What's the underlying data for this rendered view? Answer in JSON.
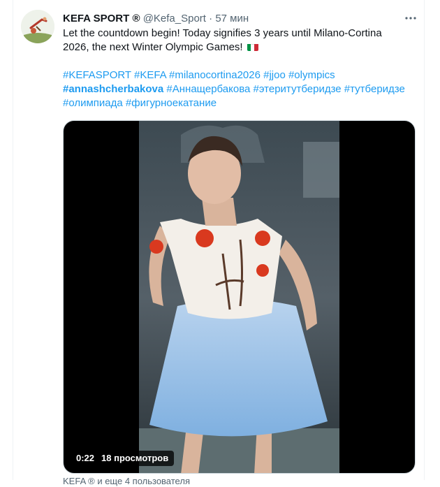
{
  "tweet": {
    "author_name": "KEFA SPORT ®",
    "handle": "@Kefa_Sport",
    "separator": "·",
    "time": "57 мин",
    "more_icon": "more-horizontal-icon",
    "text_line1": "Let the countdown begin! Today signifies 3 years until Milano-Cortina",
    "text_line2": "2026, the next Winter Olympic Games!",
    "flag_icon": "italy-flag-icon",
    "hashtags_line1": "#KEFASPORT #KEFA #milanocortina2026 #jjoo #olympics",
    "hashtag_bold": "#annashcherbakova",
    "hashtags_line2_rest": " #Аннащербакова #этеритутберидзе #тутберидзе",
    "hashtags_line3": "#олимпиада #фигурноекатание"
  },
  "video": {
    "duration": "0:22",
    "views": "18 просмотров"
  },
  "footer": {
    "text": "KEFA ® и еще 4 пользователя"
  },
  "colors": {
    "accent": "#1d9bf0",
    "muted": "#536471",
    "text": "#0f1419"
  }
}
